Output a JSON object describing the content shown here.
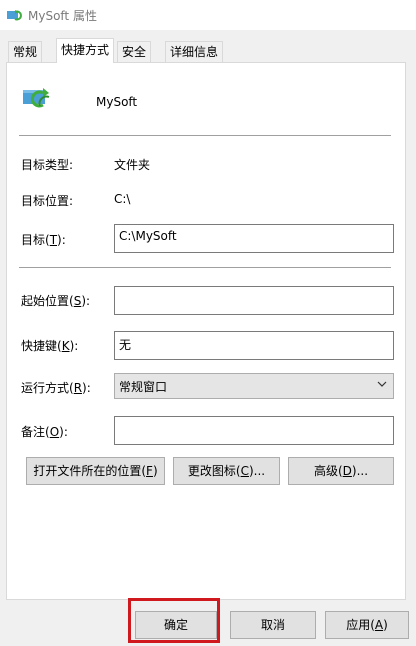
{
  "window": {
    "title": "MySoft 属性",
    "app_name": "MySoft"
  },
  "tabs": [
    {
      "label": "常规"
    },
    {
      "label": "快捷方式",
      "active": true
    },
    {
      "label": "安全"
    },
    {
      "label": "详细信息"
    }
  ],
  "shortcut": {
    "target_type_label": "目标类型:",
    "target_type_value": "文件夹",
    "target_location_label": "目标位置:",
    "target_location_value": "C:\\",
    "target_label_pre": "目标(",
    "target_label_key": "T",
    "target_label_post": "):",
    "target_value": "C:\\MySoft",
    "start_in_label_pre": "起始位置(",
    "start_in_label_key": "S",
    "start_in_label_post": "):",
    "start_in_value": "",
    "hotkey_label_pre": "快捷键(",
    "hotkey_label_key": "K",
    "hotkey_label_post": "):",
    "hotkey_value": "无",
    "run_label_pre": "运行方式(",
    "run_label_key": "R",
    "run_label_post": "):",
    "run_value": "常规窗口",
    "comment_label_pre": "备注(",
    "comment_label_key": "O",
    "comment_label_post": "):",
    "comment_value": "",
    "open_location_pre": "打开文件所在的位置(",
    "open_location_key": "F",
    "open_location_post": ")",
    "change_icon_pre": "更改图标(",
    "change_icon_key": "C",
    "change_icon_post": ")...",
    "advanced_pre": "高级(",
    "advanced_key": "D",
    "advanced_post": ")..."
  },
  "footer": {
    "ok_label": "确定",
    "cancel_label": "取消",
    "apply_pre": "应用(",
    "apply_key": "A",
    "apply_post": ")"
  },
  "icons": {
    "title_icon": "shortcut-folder-icon",
    "app_icon": "shortcut-folder-icon",
    "dropdown": "chevron-down-icon"
  },
  "colors": {
    "highlight": "#d0191f",
    "icon_green": "#3fae3f",
    "icon_blue": "#4a9fd6"
  }
}
